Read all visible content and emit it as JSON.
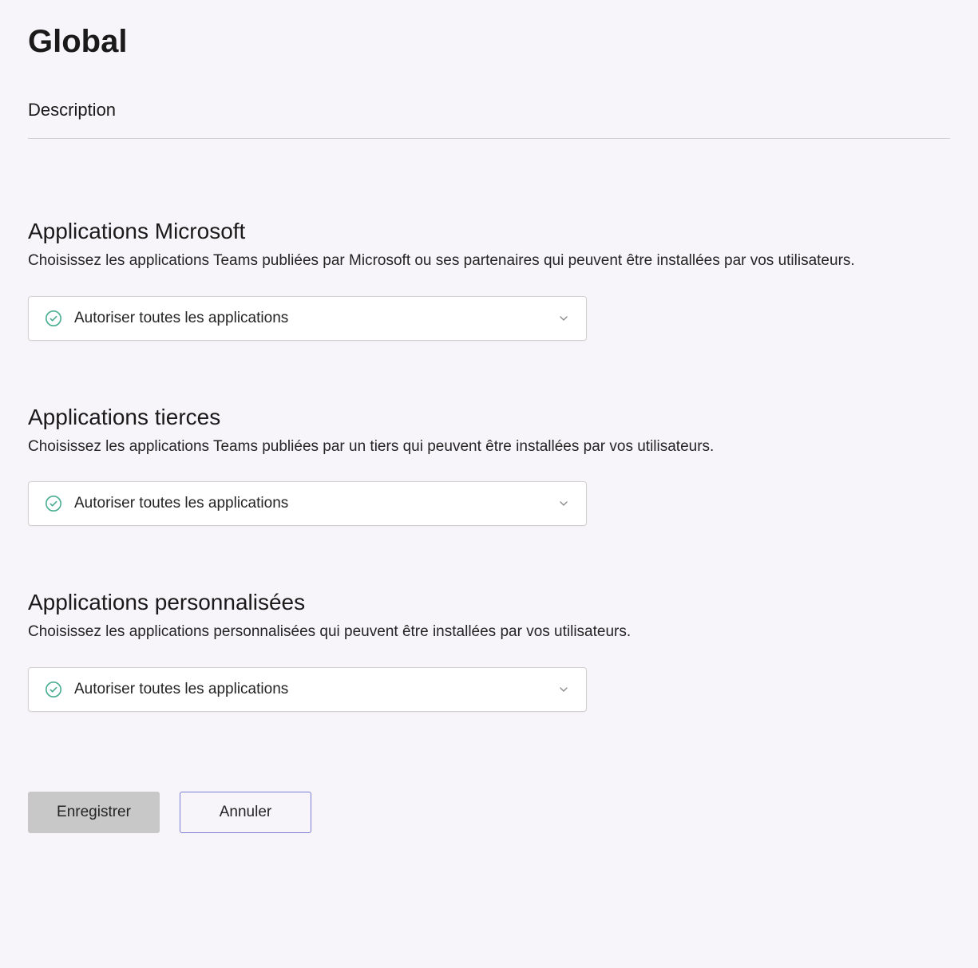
{
  "page": {
    "title": "Global",
    "description_label": "Description"
  },
  "sections": {
    "microsoft": {
      "heading": "Applications Microsoft",
      "description": "Choisissez les applications Teams publiées par Microsoft ou ses partenaires qui peuvent être installées par vos utilisateurs.",
      "dropdown_value": "Autoriser toutes les applications"
    },
    "third_party": {
      "heading": "Applications tierces",
      "description": "Choisissez les applications Teams publiées par un tiers qui peuvent être installées par vos utilisateurs.",
      "dropdown_value": "Autoriser toutes les applications"
    },
    "custom": {
      "heading": "Applications personnalisées",
      "description": "Choisissez les applications personnalisées qui peuvent être installées par vos utilisateurs.",
      "dropdown_value": "Autoriser toutes les applications"
    }
  },
  "buttons": {
    "save": "Enregistrer",
    "cancel": "Annuler"
  }
}
